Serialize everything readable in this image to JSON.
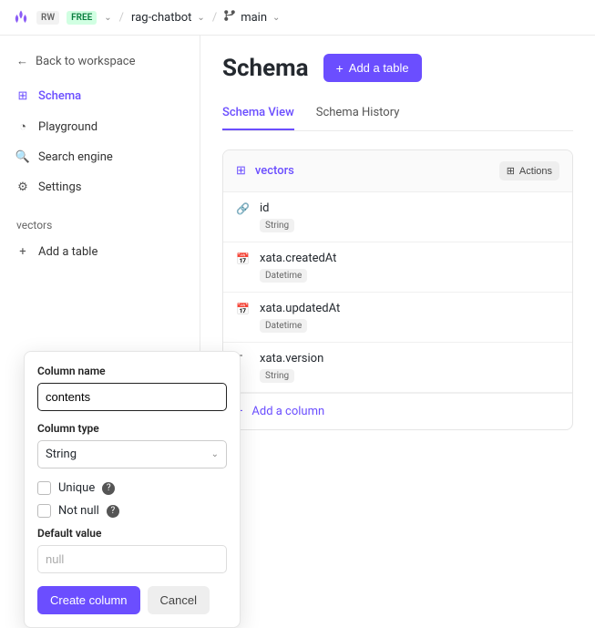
{
  "topbar": {
    "rw_badge": "RW",
    "free_badge": "FREE",
    "project": "rag-chatbot",
    "branch": "main"
  },
  "sidebar": {
    "back": "Back to workspace",
    "items": [
      {
        "label": "Schema"
      },
      {
        "label": "Playground"
      },
      {
        "label": "Search engine"
      },
      {
        "label": "Settings"
      }
    ],
    "tables_header": "vectors",
    "add_table": "Add a table"
  },
  "header": {
    "title": "Schema",
    "add_table_btn": "Add a table"
  },
  "tabs": {
    "view": "Schema View",
    "history": "Schema History"
  },
  "table_card": {
    "name": "vectors",
    "actions": "Actions",
    "columns": [
      {
        "name": "id",
        "type": "String"
      },
      {
        "name": "xata.createdAt",
        "type": "Datetime"
      },
      {
        "name": "xata.updatedAt",
        "type": "Datetime"
      },
      {
        "name": "xata.version",
        "type": "String"
      }
    ],
    "add_column": "Add a column"
  },
  "popover": {
    "name_label": "Column name",
    "name_value": "contents",
    "type_label": "Column type",
    "type_value": "String",
    "unique_label": "Unique",
    "notnull_label": "Not null",
    "default_label": "Default value",
    "default_placeholder": "null",
    "create": "Create column",
    "cancel": "Cancel"
  }
}
